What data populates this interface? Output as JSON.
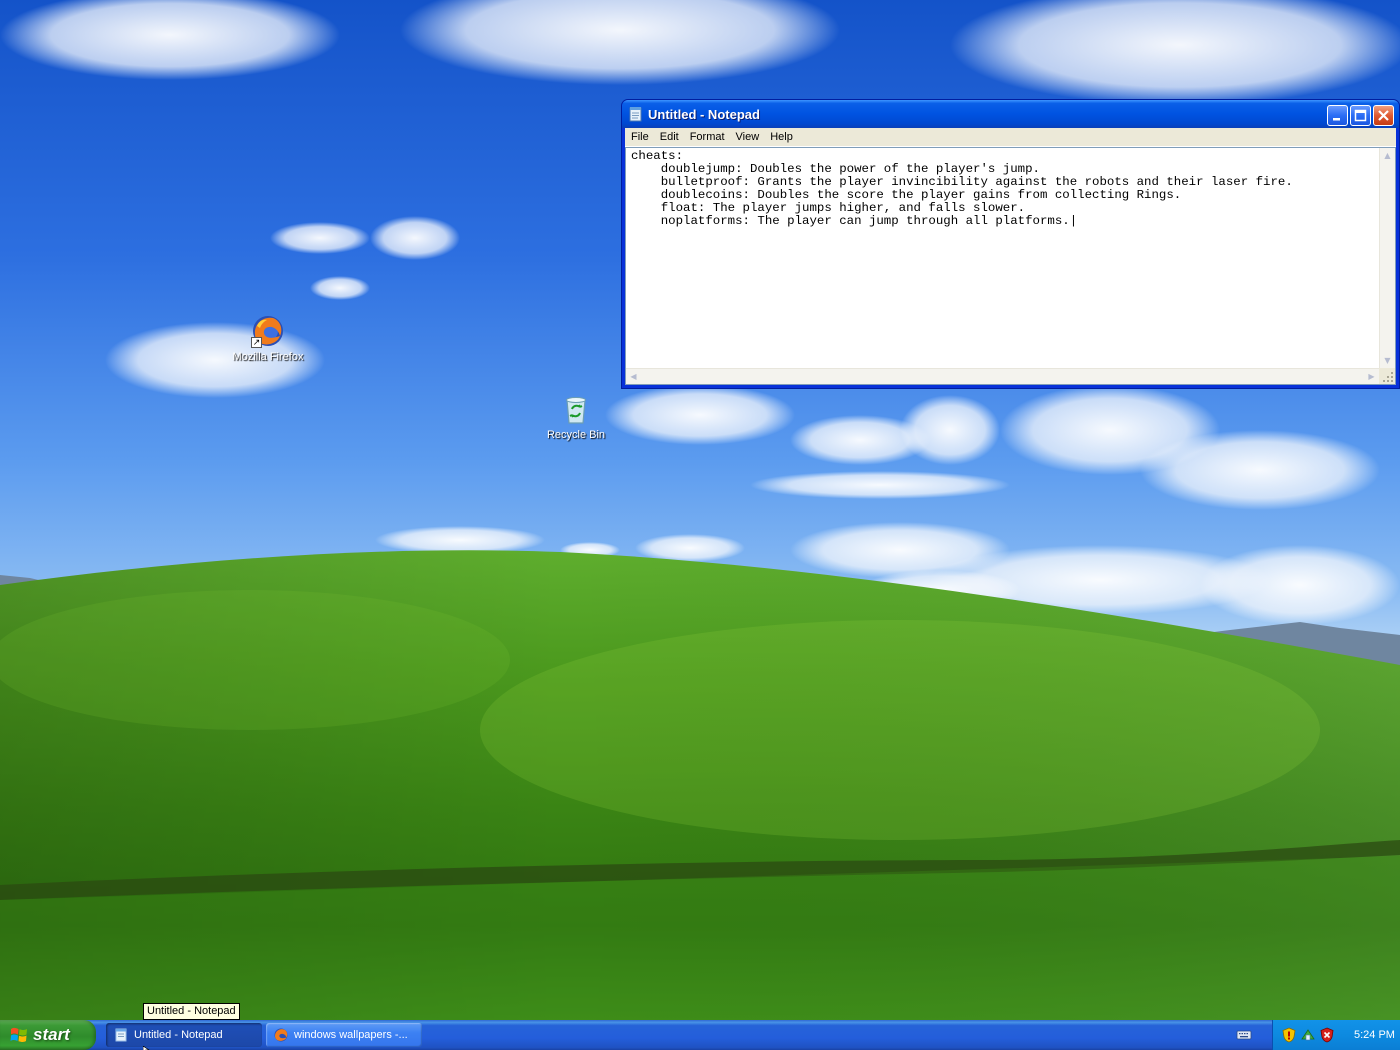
{
  "desktop": {
    "icons": [
      {
        "label": "Mozilla Firefox",
        "icon": "firefox-icon",
        "shortcut": true
      },
      {
        "label": "Recycle Bin",
        "icon": "recycle-bin-icon",
        "shortcut": false
      }
    ]
  },
  "notepad": {
    "title": "Untitled - Notepad",
    "menu": [
      "File",
      "Edit",
      "Format",
      "View",
      "Help"
    ],
    "content": "cheats:\n    doublejump: Doubles the power of the player's jump.\n    bulletproof: Grants the player invincibility against the robots and their laser fire.\n    doublecoins: Doubles the score the player gains from collecting Rings.\n    float: The player jumps higher, and falls slower.\n    noplatforms: The player can jump through all platforms.|",
    "buttons": [
      "minimize",
      "maximize",
      "close"
    ]
  },
  "tooltip": {
    "text": "Untitled - Notepad"
  },
  "taskbar": {
    "start_label": "start",
    "tasks": [
      {
        "label": "Untitled - Notepad",
        "icon": "notepad-icon",
        "active": true
      },
      {
        "label": "windows wallpapers -...",
        "icon": "firefox-icon",
        "active": false
      }
    ],
    "tray": {
      "icons": [
        "security-shield-icon",
        "network-icon",
        "security-alert-icon"
      ],
      "clock": "5:24 PM"
    }
  },
  "colors": {
    "titlebar": "#0053e1",
    "taskbar": "#245edb",
    "start_button": "#3c9a36",
    "tray": "#0d8ae0",
    "close_button": "#e05a32",
    "tooltip_bg": "#ffffe1"
  }
}
